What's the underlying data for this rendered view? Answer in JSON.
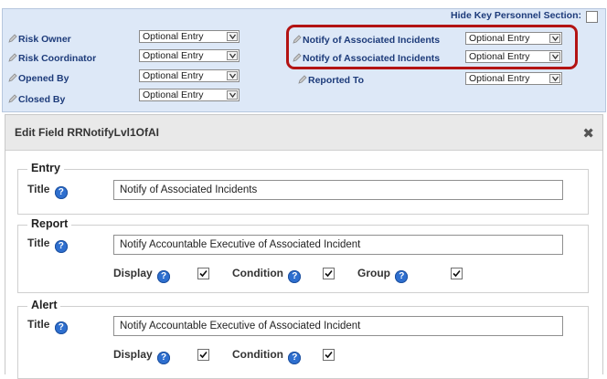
{
  "key_personnel": {
    "hide_label": "Hide Key Personnel Section:",
    "fields": [
      {
        "label": "Risk Owner",
        "value": "Optional Entry"
      },
      {
        "label": "Risk Coordinator",
        "value": "Optional Entry"
      },
      {
        "label": "Opened By",
        "value": "Optional Entry"
      },
      {
        "label": "Closed By",
        "value": "Optional Entry"
      },
      {
        "label": "Notify of Associated Incidents",
        "value": "Optional Entry"
      },
      {
        "label": "Notify of Associated Incidents",
        "value": "Optional Entry"
      },
      {
        "label": "Reported To",
        "value": "Optional Entry"
      }
    ],
    "highlight_color": "#b31313"
  },
  "dialog": {
    "title": "Edit Field RRNotifyLvl1OfAI",
    "close_glyph": "✖",
    "entry": {
      "legend": "Entry",
      "title_label": "Title",
      "title_value": "Notify of Associated Incidents"
    },
    "report": {
      "legend": "Report",
      "title_label": "Title",
      "title_value": "Notify Accountable Executive of Associated Incident",
      "display_label": "Display",
      "condition_label": "Condition",
      "group_label": "Group"
    },
    "alert": {
      "legend": "Alert",
      "title_label": "Title",
      "title_value": "Notify Accountable Executive of Associated Incident",
      "display_label": "Display",
      "condition_label": "Condition"
    },
    "help_glyph": "?"
  }
}
